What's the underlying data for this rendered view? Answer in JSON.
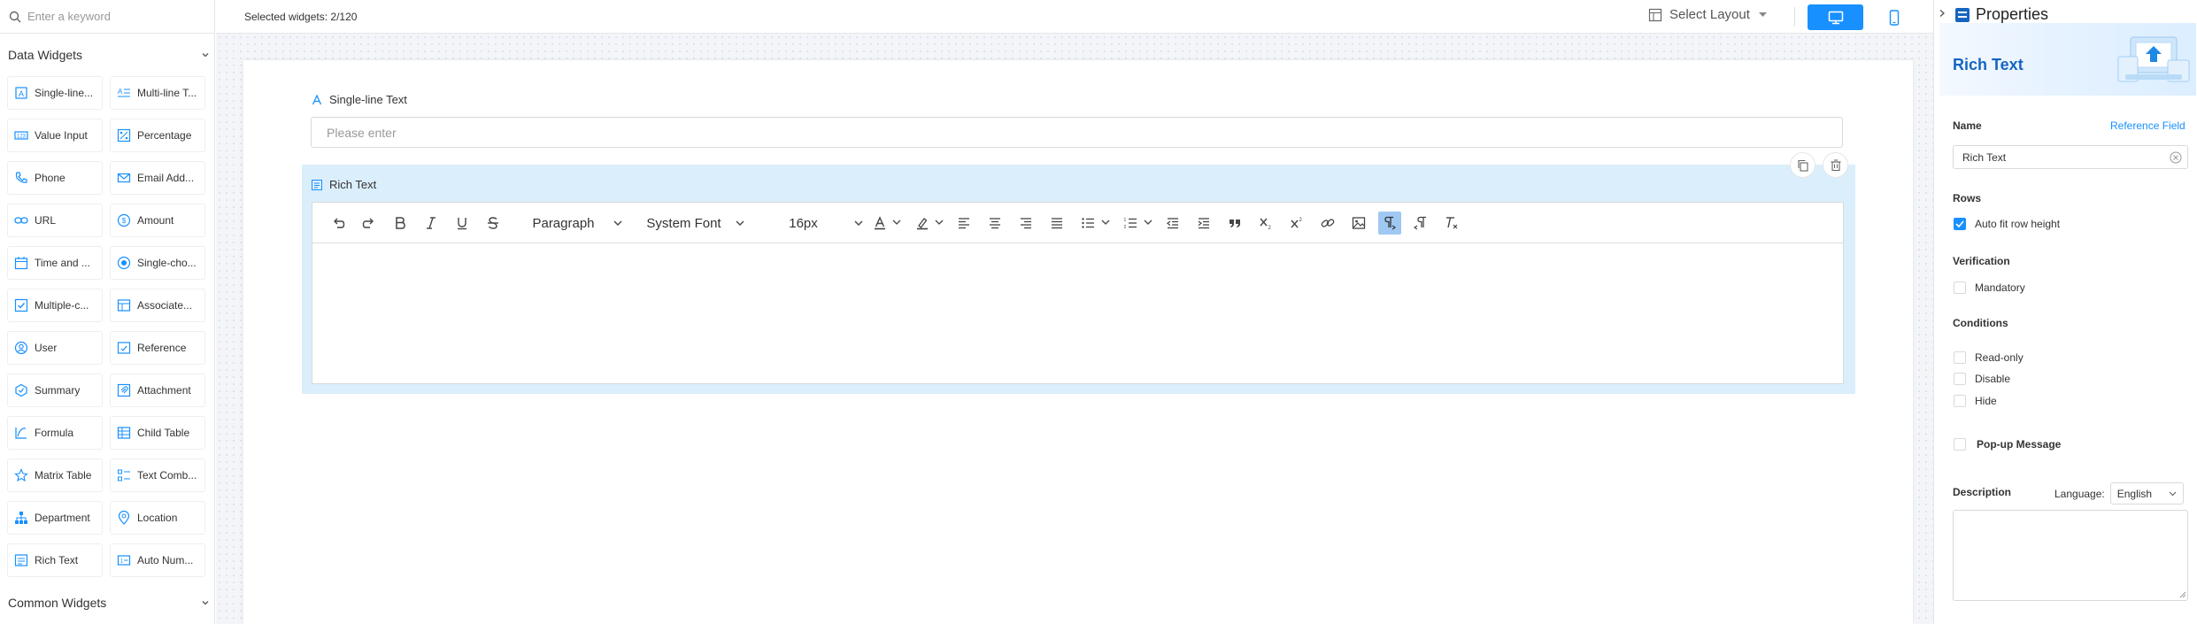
{
  "search": {
    "placeholder": "Enter a keyword"
  },
  "sections": {
    "data_widgets": "Data Widgets",
    "common_widgets": "Common Widgets"
  },
  "widgets": [
    {
      "label": "Single-line...",
      "icon": "text-a-icon"
    },
    {
      "label": "Multi-line T...",
      "icon": "multiline-text-icon"
    },
    {
      "label": "Value Input",
      "icon": "number-input-icon"
    },
    {
      "label": "Percentage",
      "icon": "percentage-icon"
    },
    {
      "label": "Phone",
      "icon": "phone-icon"
    },
    {
      "label": "Email Add...",
      "icon": "email-icon"
    },
    {
      "label": "URL",
      "icon": "link-icon"
    },
    {
      "label": "Amount",
      "icon": "currency-icon"
    },
    {
      "label": "Time and ...",
      "icon": "calendar-icon"
    },
    {
      "label": "Single-cho...",
      "icon": "radio-icon"
    },
    {
      "label": "Multiple-c...",
      "icon": "checkbox-icon"
    },
    {
      "label": "Associate...",
      "icon": "associate-icon"
    },
    {
      "label": "User",
      "icon": "user-icon"
    },
    {
      "label": "Reference",
      "icon": "reference-icon"
    },
    {
      "label": "Summary",
      "icon": "summary-icon"
    },
    {
      "label": "Attachment",
      "icon": "attachment-icon"
    },
    {
      "label": "Formula",
      "icon": "formula-icon"
    },
    {
      "label": "Child Table",
      "icon": "table-icon"
    },
    {
      "label": "Matrix Table",
      "icon": "matrix-icon"
    },
    {
      "label": "Text Comb...",
      "icon": "text-combination-icon"
    },
    {
      "label": "Department",
      "icon": "org-chart-icon"
    },
    {
      "label": "Location",
      "icon": "location-pin-icon"
    },
    {
      "label": "Rich Text",
      "icon": "rich-text-icon"
    },
    {
      "label": "Auto Num...",
      "icon": "auto-number-icon"
    }
  ],
  "topbar": {
    "selected": "Selected widgets: 2/120",
    "layout": "Select Layout"
  },
  "form": {
    "single_line": {
      "label": "Single-line Text",
      "placeholder": "Please enter"
    },
    "rich_text": {
      "label": "Rich Text"
    }
  },
  "toolbar": {
    "paragraph": "Paragraph",
    "font": "System Font",
    "size": "16px"
  },
  "properties": {
    "title": "Properties",
    "widget_type": "Rich Text",
    "name_label": "Name",
    "reference_field": "Reference Field",
    "name_value": "Rich Text",
    "rows_label": "Rows",
    "auto_fit": "Auto fit row height",
    "verification_label": "Verification",
    "mandatory": "Mandatory",
    "conditions_label": "Conditions",
    "read_only": "Read-only",
    "disable": "Disable",
    "hide": "Hide",
    "popup": "Pop-up Message",
    "description_label": "Description",
    "language_label": "Language:",
    "language_value": "English"
  },
  "colors": {
    "accent": "#1890ff",
    "selected_block": "#dbeefb",
    "title_blue": "#1565c0"
  }
}
